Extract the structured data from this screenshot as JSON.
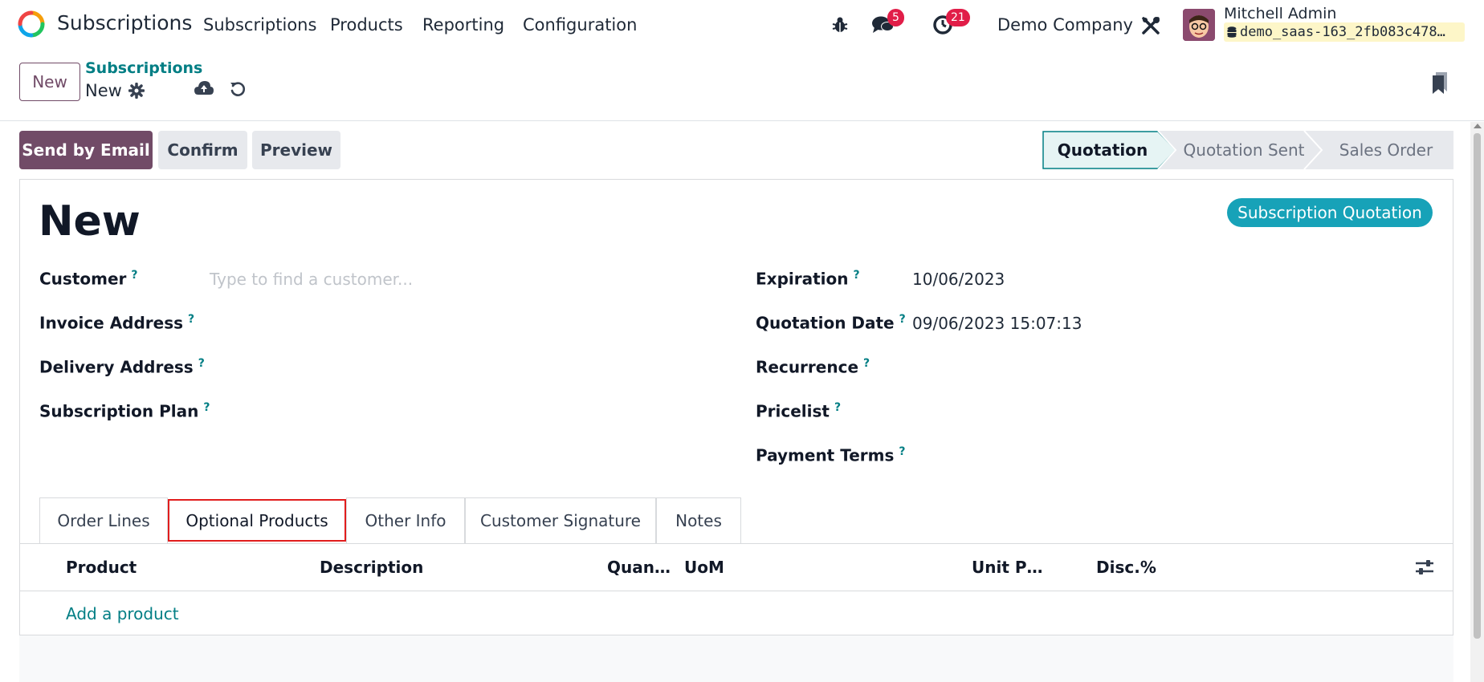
{
  "navbar": {
    "app_name": "Subscriptions",
    "menus": [
      "Subscriptions",
      "Products",
      "Reporting",
      "Configuration"
    ],
    "messages_count": "5",
    "activities_count": "21",
    "company": "Demo Company",
    "user_name": "Mitchell Admin",
    "database": "demo_saas-163_2fb083c478…"
  },
  "control_panel": {
    "new_label": "New",
    "breadcrumb_parent": "Subscriptions",
    "breadcrumb_current": "New"
  },
  "actions": {
    "send_email": "Send by Email",
    "confirm": "Confirm",
    "preview": "Preview"
  },
  "status_stages": [
    "Quotation",
    "Quotation Sent",
    "Sales Order"
  ],
  "status_active": "Quotation",
  "record": {
    "title": "New",
    "ribbon": "Subscription Quotation"
  },
  "fields_left": {
    "customer_label": "Customer",
    "customer_placeholder": "Type to find a customer...",
    "invoice_address_label": "Invoice Address",
    "delivery_address_label": "Delivery Address",
    "subscription_plan_label": "Subscription Plan"
  },
  "fields_right": {
    "expiration_label": "Expiration",
    "expiration_value": "10/06/2023",
    "quotation_date_label": "Quotation Date",
    "quotation_date_value": "09/06/2023 15:07:13",
    "recurrence_label": "Recurrence",
    "pricelist_label": "Pricelist",
    "payment_terms_label": "Payment Terms"
  },
  "help_mark": "?",
  "tabs": [
    "Order Lines",
    "Optional Products",
    "Other Info",
    "Customer Signature",
    "Notes"
  ],
  "active_tab": "Optional Products",
  "table": {
    "columns": [
      "Product",
      "Description",
      "Quan…",
      "UoM",
      "Unit P…",
      "Disc.%"
    ],
    "add_product": "Add a product"
  },
  "colors": {
    "brand": "#714b67",
    "link": "#017e84",
    "ribbon": "#17a2b8",
    "badge": "#e11d48",
    "highlight": "#e11d1d"
  }
}
